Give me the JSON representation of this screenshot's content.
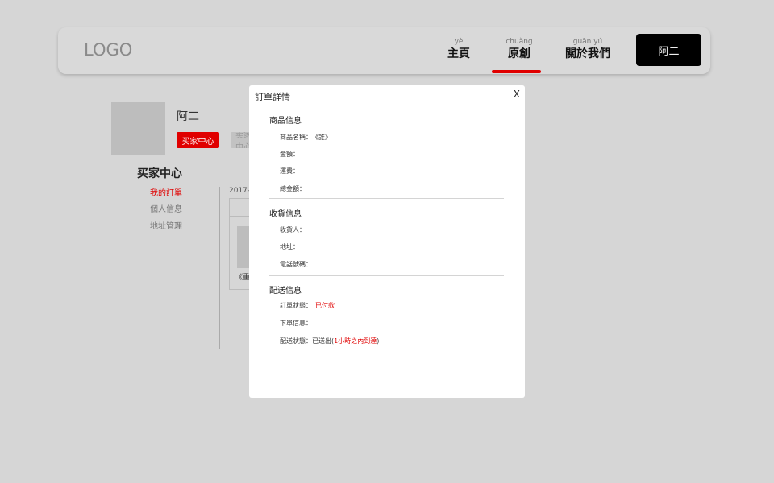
{
  "header": {
    "logo": "LOGO",
    "nav": [
      {
        "pinyin": "yè",
        "label": "主頁"
      },
      {
        "pinyin": "chuàng",
        "label": "原創"
      },
      {
        "pinyin": "guān yú",
        "label": "關於我們"
      }
    ],
    "user_button": "阿二"
  },
  "profile": {
    "username": "阿二",
    "tab_buyer": "买家中心",
    "tab_seller": "卖家中心"
  },
  "sidebar": {
    "title": "买家中心",
    "items": [
      "我的訂單",
      "個人信息",
      "地址管理"
    ]
  },
  "orders": {
    "date": "2017-0",
    "item_name": "《重"
  },
  "modal": {
    "title": "訂單詳情",
    "close": "X",
    "product": {
      "title": "商品信息",
      "name_label": "商品名稱：",
      "name_value": "《誰》",
      "amount_label": "金額：",
      "shipping_label": "運費：",
      "total_label": "總金額："
    },
    "receiver": {
      "title": "收貨信息",
      "recipient_label": "收貨人：",
      "address_label": "地址：",
      "phone_label": "電話號碼："
    },
    "delivery": {
      "title": "配送信息",
      "order_status_label": "訂單狀態：",
      "order_status_value": "已付款",
      "order_info_label": "下單信息：",
      "delivery_status_label": "配送狀態：",
      "delivery_status_prefix": "已送出(",
      "delivery_status_highlight": "1小時之內到達",
      "delivery_status_suffix": ")"
    }
  },
  "colors": {
    "accent": "#e00000",
    "background": "#d6d6d6",
    "user_button": "#000000"
  }
}
